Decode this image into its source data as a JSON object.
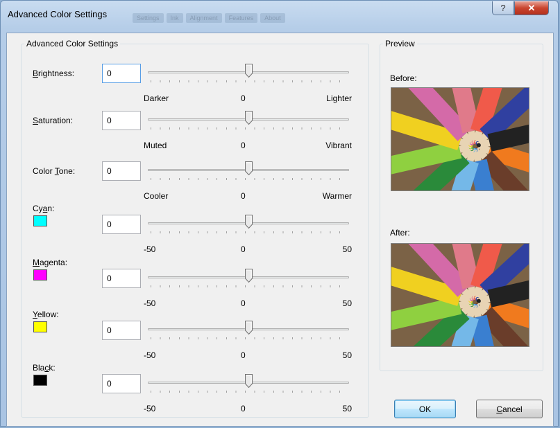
{
  "window": {
    "title": "Advanced Color Settings",
    "help_glyph": "?",
    "close_glyph": "✕"
  },
  "background_tabs": [
    "Settings",
    "Ink",
    "Alignment",
    "Features",
    "About"
  ],
  "settings_group": {
    "legend": "Advanced Color Settings",
    "rows": [
      {
        "label_pre": "",
        "label_key": "B",
        "label_post": "rightness:",
        "value": "0",
        "scale": [
          "Darker",
          "0",
          "Lighter"
        ],
        "position": 0.5,
        "swatch": null
      },
      {
        "label_pre": "",
        "label_key": "S",
        "label_post": "aturation:",
        "value": "0",
        "scale": [
          "Muted",
          "0",
          "Vibrant"
        ],
        "position": 0.5,
        "swatch": null
      },
      {
        "label_pre": "Color ",
        "label_key": "T",
        "label_post": "one:",
        "value": "0",
        "scale": [
          "Cooler",
          "0",
          "Warmer"
        ],
        "position": 0.5,
        "swatch": null
      },
      {
        "label_pre": "Cy",
        "label_key": "a",
        "label_post": "n:",
        "value": "0",
        "scale": [
          "-50",
          "0",
          "50"
        ],
        "position": 0.5,
        "swatch": "#00ffff"
      },
      {
        "label_pre": "",
        "label_key": "M",
        "label_post": "agenta:",
        "value": "0",
        "scale": [
          "-50",
          "0",
          "50"
        ],
        "position": 0.5,
        "swatch": "#ff00ff"
      },
      {
        "label_pre": "",
        "label_key": "Y",
        "label_post": "ellow:",
        "value": "0",
        "scale": [
          "-50",
          "0",
          "50"
        ],
        "position": 0.5,
        "swatch": "#ffff00"
      },
      {
        "label_pre": "Bla",
        "label_key": "c",
        "label_post": "k:",
        "value": "0",
        "scale": [
          "-50",
          "0",
          "50"
        ],
        "position": 0.5,
        "swatch": "#000000"
      }
    ]
  },
  "preview_group": {
    "legend": "Preview",
    "before_label": "Before:",
    "after_label": "After:"
  },
  "buttons": {
    "ok_label": "OK",
    "cancel_pre": "",
    "cancel_key": "C",
    "cancel_post": "ancel"
  }
}
